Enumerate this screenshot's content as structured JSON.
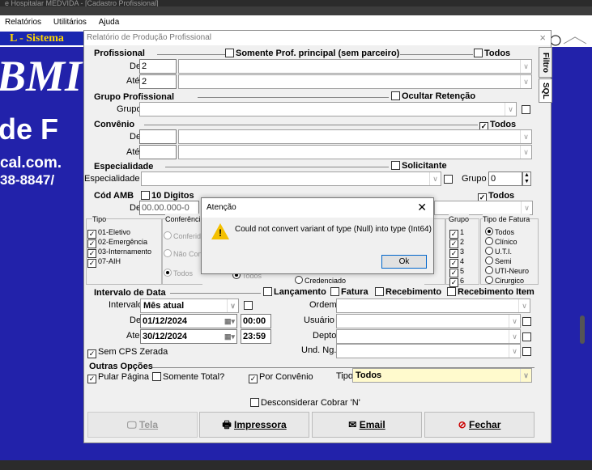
{
  "background": {
    "title_bar": "e Hospitalar MEDVIDA - [Cadastro Profissional]",
    "menu": [
      "Relatórios",
      "Utilitários",
      "Ajuda"
    ],
    "sistema": "L - Sistema",
    "big1": "BMI",
    "big2": "de F",
    "big3": "cal.com.",
    "big4": "38-8847/"
  },
  "window": {
    "title": "Relatório de Produção Profissional",
    "close": "×",
    "tabs": [
      "Filtro",
      "SQL"
    ]
  },
  "profissional": {
    "section": "Profissional",
    "somente_label": "Somente Prof. principal (sem parceiro)",
    "todos_label": "Todos",
    "de_label": "De",
    "de_value": "2",
    "ate_label": "Até",
    "ate_value": "2"
  },
  "grupo_profissional": {
    "section": "Grupo Profissional",
    "ocultar_label": "Ocultar Retenção",
    "grupo_label": "Grupo"
  },
  "convenio": {
    "section": "Convênio",
    "todos_label": "Todos",
    "de_label": "De",
    "ate_label": "Até"
  },
  "especialidade": {
    "section": "Especialidade",
    "solicitante_label": "Solicitante",
    "esp_label": "Especialidade",
    "grupo_label": "Grupo",
    "grupo_value": "0"
  },
  "cod_amb": {
    "section": "Cód AMB",
    "digitos_label": "10 Digitos",
    "todos_label": "Todos",
    "de_label": "De",
    "de_value": "00.00.000-0"
  },
  "tipo": {
    "label": "Tipo",
    "items": [
      "01-Eletivo",
      "02-Emergência",
      "03-Internamento",
      "07-AIH"
    ]
  },
  "conferencia": {
    "label": "Conferênci",
    "items": [
      "Conferid",
      "Não Con",
      "Todos"
    ]
  },
  "credenciado": {
    "todos": "Todos",
    "credenciado": "Credenciado"
  },
  "grupo_list": {
    "label": "Grupo",
    "items": [
      "1",
      "2",
      "3",
      "4",
      "5",
      "6"
    ]
  },
  "tipo_fatura": {
    "label": "Tipo de Fatura",
    "items": [
      "Todos",
      "Clínico",
      "U.T.I.",
      "Semi",
      "UTI-Neuro",
      "Cirurgico"
    ]
  },
  "intervalo": {
    "section": "Intervalo  de Data",
    "lancamento": "Lançamento",
    "fatura": "Fatura",
    "recebimento": "Recebimento",
    "recebimento_item": "Recebimento Item",
    "intervalo_label": "Intervalo",
    "intervalo_value": "Mês atual",
    "de_label": "De",
    "de_date": "01/12/2024",
    "de_time": "00:00",
    "ate_label": "Ate",
    "ate_date": "30/12/2024",
    "ate_time": "23:59",
    "sem_cps": "Sem CPS Zerada",
    "ordem_label": "Ordem",
    "usuario_label": "Usuário",
    "depto_label": "Depto",
    "und_label": "Und. Ng."
  },
  "outras": {
    "section": "Outras Opções",
    "pular": "Pular Página",
    "somente_total": "Somente Total?",
    "por_convenio": "Por Convênio",
    "tipo_label": "Tipo",
    "tipo_value": "Todos",
    "desconsiderar": "Desconsiderar Cobrar 'N'"
  },
  "buttons": {
    "tela": "Tela",
    "impressora": "Impressora",
    "email": "Email",
    "fechar": "Fechar"
  },
  "dialog": {
    "title": "Atenção",
    "close": "✕",
    "message": "Could not convert variant of type (Null) into type (Int64)",
    "ok": "Ok"
  },
  "colors": {
    "app_bg": "#2222aa",
    "dialog_warn": "#f4c000",
    "date_bg": "#fffacd",
    "fechar_icon": "#cc0000"
  }
}
